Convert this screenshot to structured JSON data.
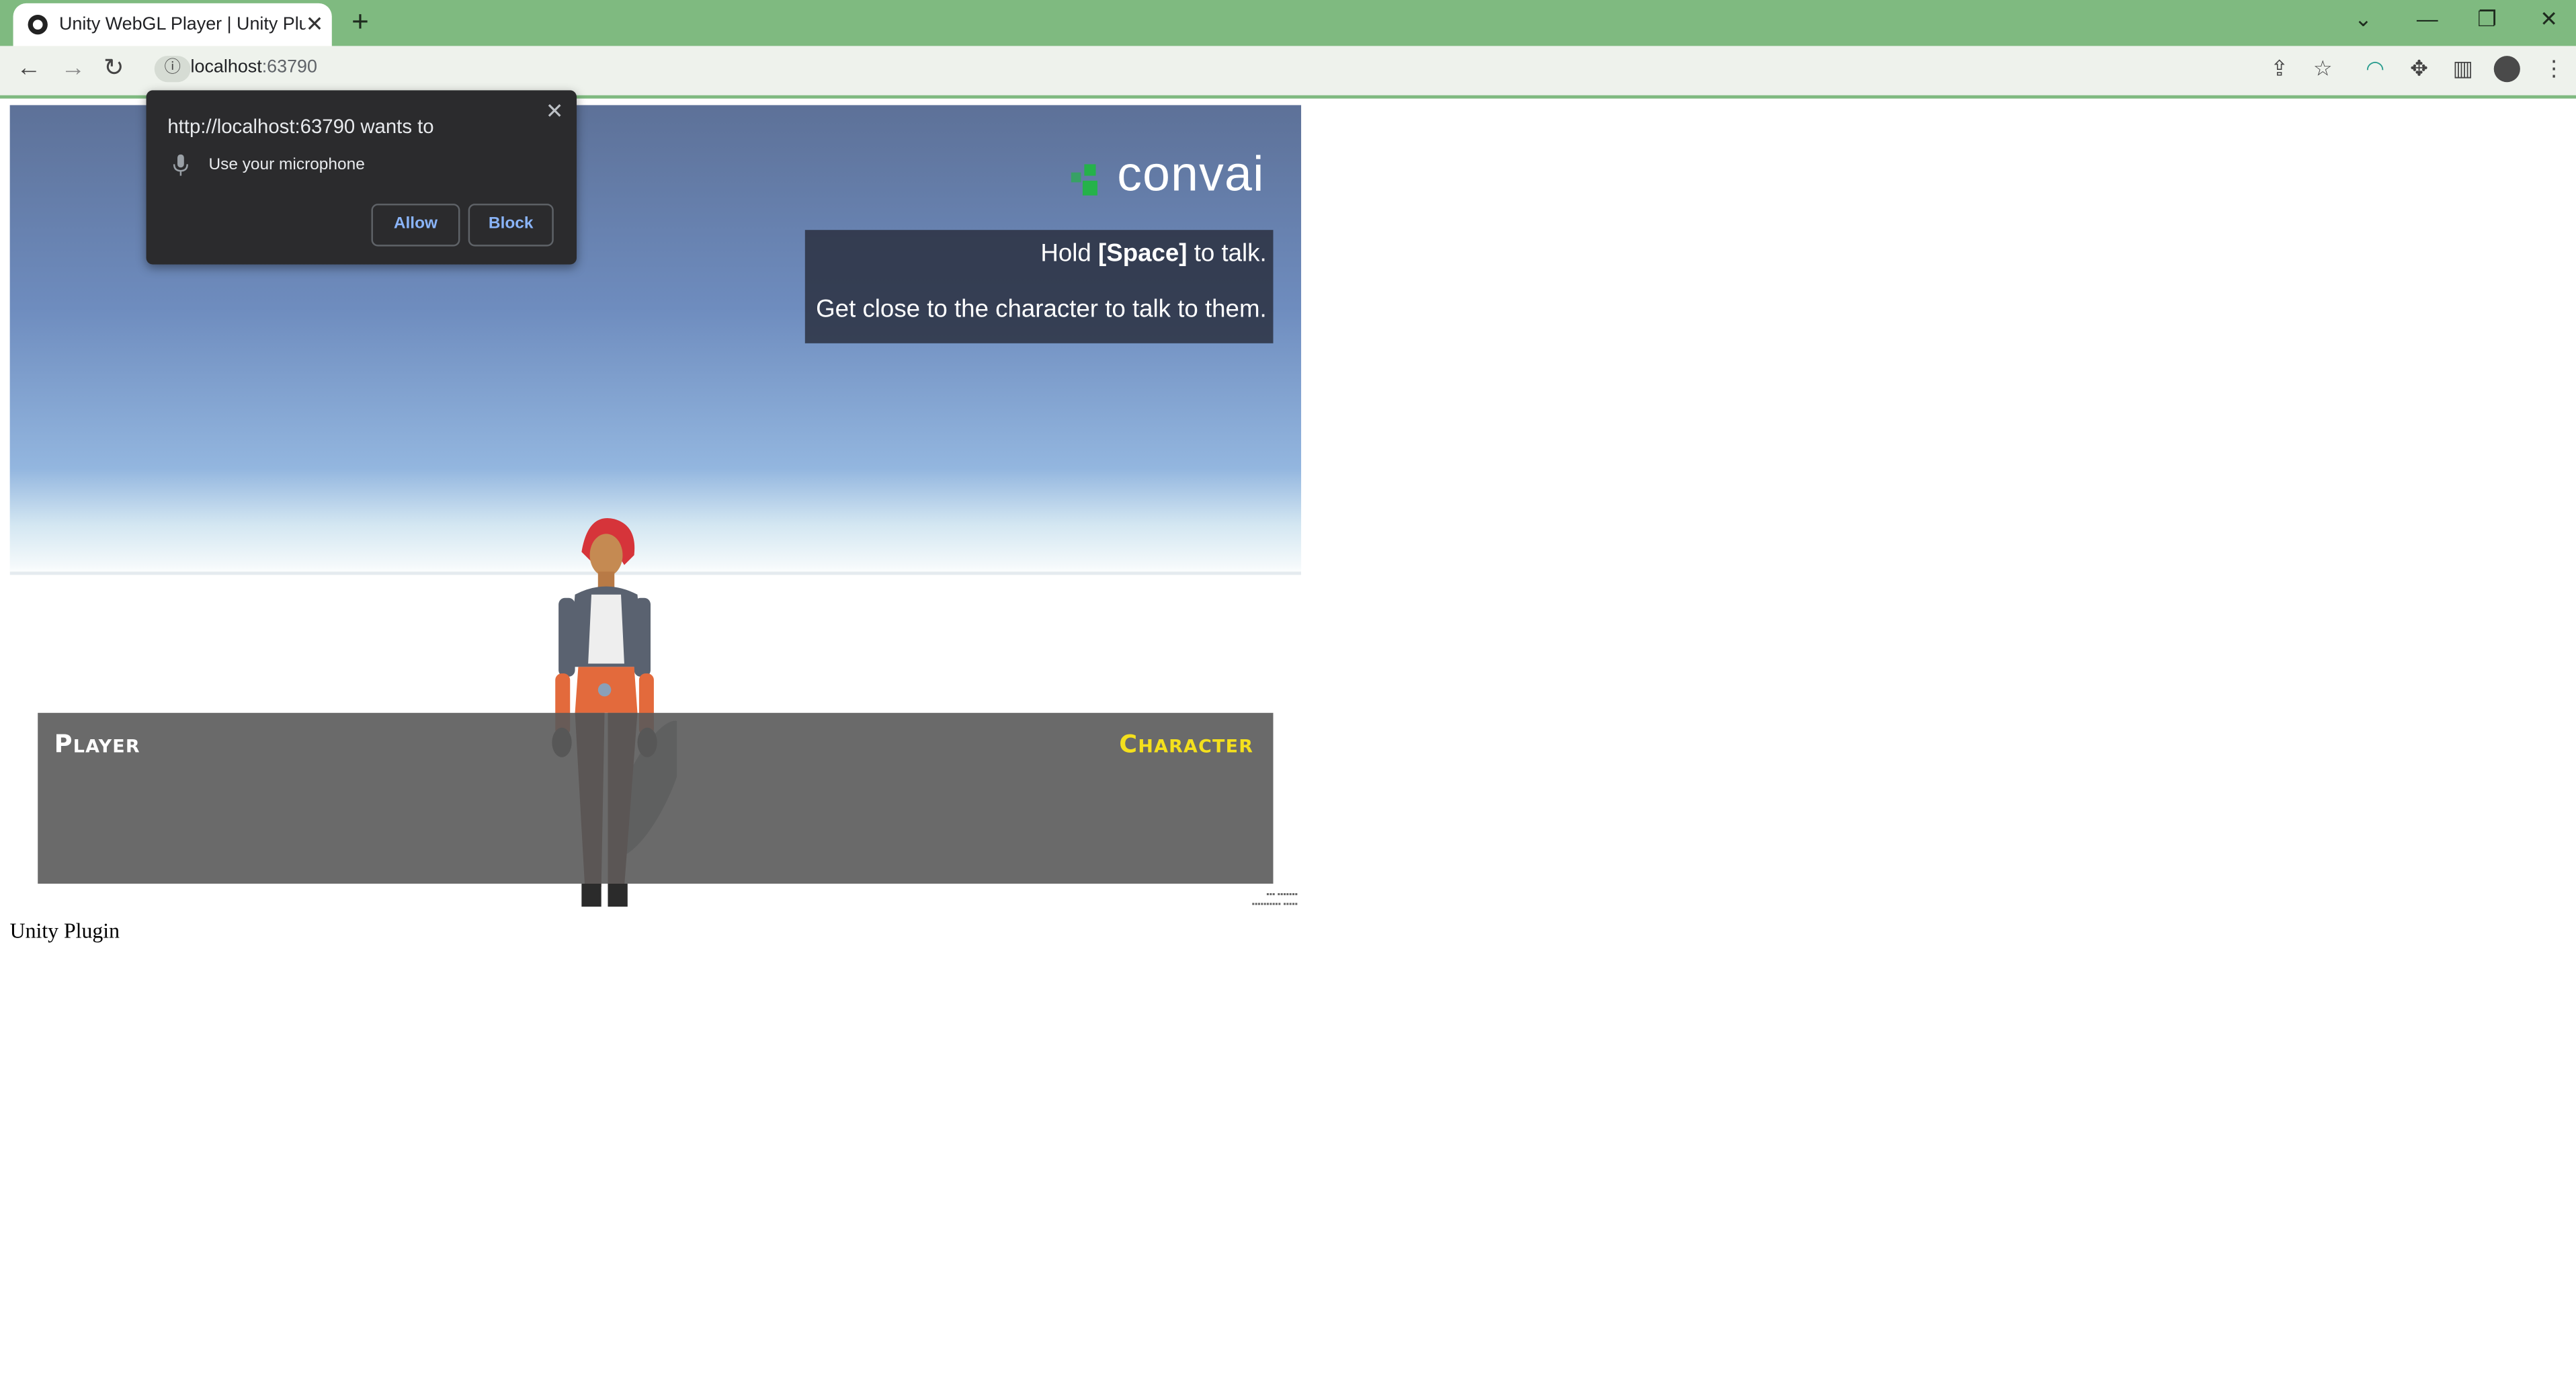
{
  "browser": {
    "tab": {
      "title": "Unity WebGL Player | Unity Plugin"
    },
    "new_tab": "+",
    "address": {
      "host": "localhost",
      "port": ":63790"
    }
  },
  "game": {
    "logo_text": "convai",
    "instructions": {
      "line1_prefix": "Hold",
      "line1_key": "[Space]",
      "line1_suffix": "to talk.",
      "line2": "Get close to the character to talk to them."
    },
    "chat": {
      "player_label": "Player",
      "character_label": "Character"
    },
    "colors": {
      "logo_accent": "#25b24a",
      "character_label": "#f4e01d"
    }
  },
  "page": {
    "caption": "Unity Plugin"
  },
  "permission_popup": {
    "title": "http://localhost:63790 wants to",
    "request": "Use your microphone",
    "allow_label": "Allow",
    "block_label": "Block"
  }
}
